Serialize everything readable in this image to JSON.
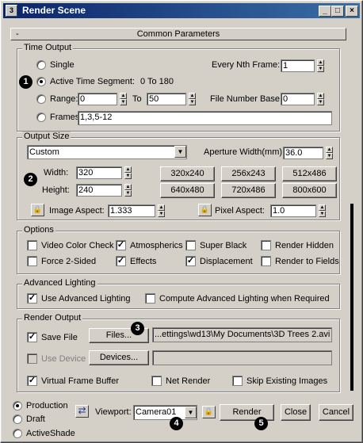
{
  "window": {
    "title": "Render Scene",
    "icon": "3ds-max-icon",
    "minimize": "_",
    "maximize": "□",
    "close": "×"
  },
  "rollout": {
    "title": "Common Parameters",
    "toggle": "-"
  },
  "time_output": {
    "title": "Time Output",
    "single": "Single",
    "every_nth_label": "Every Nth Frame:",
    "every_nth_value": "1",
    "active_segment": "Active Time Segment:",
    "active_range": "0 To 180",
    "range": "Range:",
    "range_from": "0",
    "range_to_label": "To",
    "range_to": "50",
    "file_base_label": "File Number Base:",
    "file_base_value": "0",
    "frames": "Frames",
    "frames_value": "1,3,5-12"
  },
  "output_size": {
    "title": "Output Size",
    "preset": "Custom",
    "aperture_label": "Aperture Width(mm):",
    "aperture_value": "36.0",
    "width_label": "Width:",
    "width_value": "320",
    "height_label": "Height:",
    "height_value": "240",
    "presets": [
      "320x240",
      "256x243",
      "512x486",
      "640x480",
      "720x486",
      "800x600"
    ],
    "image_aspect_label": "Image Aspect:",
    "image_aspect_value": "1.333",
    "pixel_aspect_label": "Pixel Aspect:",
    "pixel_aspect_value": "1.0"
  },
  "options": {
    "title": "Options",
    "video_color": "Video Color Check",
    "atmospherics": "Atmospherics",
    "super_black": "Super Black",
    "render_hidden": "Render Hidden",
    "force_2sided": "Force 2-Sided",
    "effects": "Effects",
    "displacement": "Displacement",
    "render_fields": "Render to Fields"
  },
  "advanced_lighting": {
    "title": "Advanced Lighting",
    "use": "Use Advanced Lighting",
    "compute": "Compute Advanced Lighting when Required"
  },
  "render_output": {
    "title": "Render Output",
    "save_file": "Save File",
    "files_button": "Files...",
    "file_path": "...ettings\\wd13\\My Documents\\3D Trees 2.avi",
    "use_device": "Use Device",
    "devices_button": "Devices...",
    "vfb": "Virtual Frame Buffer",
    "net_render": "Net Render",
    "skip_existing": "Skip Existing Images"
  },
  "bottom": {
    "production": "Production",
    "draft": "Draft",
    "activeshade": "ActiveShade",
    "viewport_label": "Viewport:",
    "viewport_value": "Camera01",
    "render": "Render",
    "close": "Close",
    "cancel": "Cancel"
  },
  "badges": [
    "1",
    "2",
    "3",
    "4",
    "5"
  ],
  "check_mark": "✓",
  "spinner_up": "▲",
  "spinner_down": "▼",
  "dropdown_arrow": "▼",
  "lock_glyph": "🔒",
  "swap_glyph": "⇄"
}
